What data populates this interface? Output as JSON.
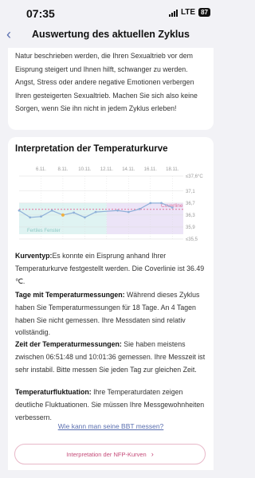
{
  "status": {
    "time": "07:35",
    "network": "LTE",
    "battery": "87"
  },
  "nav": {
    "back_icon": "chevron-left-icon",
    "title": "Auswertung des aktuellen Zyklus"
  },
  "intro_text": "Natur beschrieben werden, die Ihren Sexualtrieb vor dem Eisprung steigert und Ihnen hilft, schwanger zu werden. Angst, Stress oder andere negative Emotionen verbergen Ihren gesteigerten Sexualtrieb. Machen Sie sich also keine Sorgen, wenn Sie ihn nicht in jedem Zyklus erleben!",
  "section": {
    "title": "Interpretation der Temperaturkurve"
  },
  "chart_data": {
    "type": "line",
    "x_dates": [
      "6.11.",
      "8.11.",
      "10.11.",
      "12.11.",
      "14.11.",
      "16.11.",
      "18.11."
    ],
    "y_ticks": [
      "≤37,6°C",
      "37,1",
      "36,7",
      "36,3",
      "35,9",
      "≤35,5"
    ],
    "ylim": [
      35.5,
      37.6
    ],
    "series": [
      {
        "x": [
          4,
          5,
          6,
          7,
          8,
          9,
          10,
          11,
          13,
          14,
          15,
          16,
          17,
          18
        ],
        "y": [
          36.45,
          36.22,
          36.25,
          36.45,
          36.3,
          36.38,
          36.22,
          36.4,
          36.45,
          36.4,
          36.5,
          36.7,
          36.7,
          36.55
        ]
      }
    ],
    "x_start_day": 4,
    "coverline": {
      "label": "Coverline",
      "value": 36.49
    },
    "fertile_window": {
      "label": "Fertiles Fenster",
      "from": 4,
      "to": 11
    },
    "luteal_phase": {
      "from": 12,
      "to": 19
    },
    "highlight_point_index": 4,
    "colors": {
      "line": "#8fb0d8",
      "coverline": "#e0709a",
      "fertile": "#dff3f2",
      "luteal": "#ece4f7",
      "highlight": "#f0b040",
      "grid": "#dddddd"
    }
  },
  "paragraphs": [
    {
      "label": "Kurventyp:",
      "text": "Es konnte ein Eisprung anhand Ihrer Temperaturkurve festgestellt werden. Die Coverlinie ist 36.49 ℃."
    },
    {
      "label": "Tage mit Temperaturmessungen:",
      "text": " Während dieses Zyklus haben Sie Temperaturmessungen für 18 Tage. An 4 Tagen haben Sie nicht gemessen. Ihre Messdaten sind relativ vollständig."
    },
    {
      "label": "Zeit der Temperaturmessungen:",
      "text": " Sie haben meistens zwischen 06:51:48 und 10:01:36 gemessen. Ihre Messzeit ist sehr instabil. Bitte messen Sie jeden Tag zur gleichen Zeit."
    },
    {
      "label": "Temperaturfluktuation:",
      "text": " Ihre Temperaturdaten zeigen deutliche Fluktuationen. Sie müssen Ihre Messgewohnheiten verbessern."
    }
  ],
  "link_text": "Wie kann man seine BBT messen?",
  "nfp_button": {
    "label": "Interpretation der NFP-Kurven",
    "icon": "chevron-right-icon"
  }
}
